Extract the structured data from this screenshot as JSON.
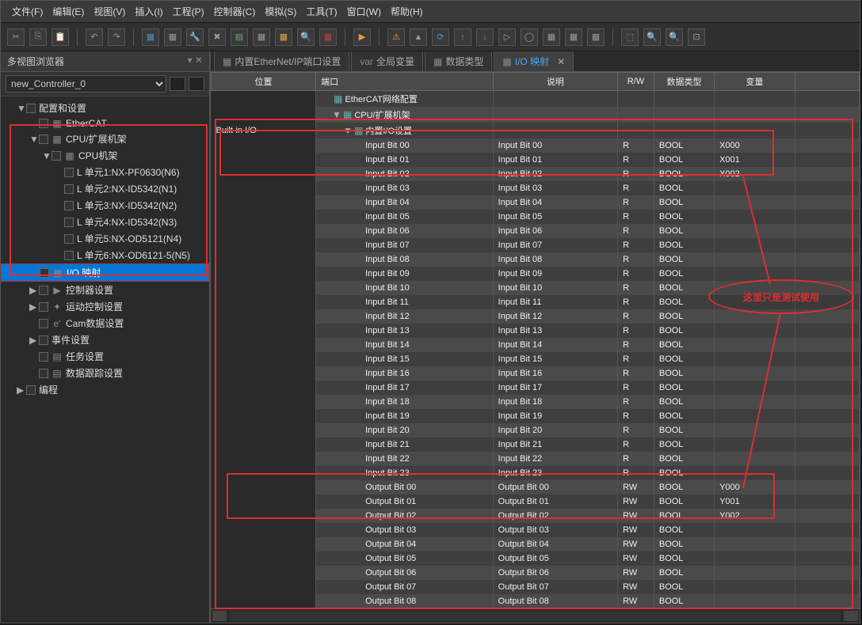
{
  "menu": [
    "文件(F)",
    "编辑(E)",
    "视图(V)",
    "插入(I)",
    "工程(P)",
    "控制器(C)",
    "模拟(S)",
    "工具(T)",
    "窗口(W)",
    "帮助(H)"
  ],
  "sidebar": {
    "title": "多视图浏览器",
    "controller": "new_Controller_0",
    "tree": [
      {
        "label": "配置和设置",
        "cls": "ind-1",
        "arrow": "▼"
      },
      {
        "label": "EtherCAT",
        "cls": "ind-2",
        "icon": "▦"
      },
      {
        "label": "CPU/扩展机架",
        "cls": "ind-2",
        "arrow": "▼",
        "icon": "▦"
      },
      {
        "label": "CPU机架",
        "cls": "ind-3",
        "arrow": "▼",
        "icon": "▦"
      },
      {
        "label": "单元1:NX-PF0630(N6)",
        "cls": "ind-4",
        "pre": "L "
      },
      {
        "label": "单元2:NX-ID5342(N1)",
        "cls": "ind-4",
        "pre": "L "
      },
      {
        "label": "单元3:NX-ID5342(N2)",
        "cls": "ind-4",
        "pre": "L "
      },
      {
        "label": "单元4:NX-ID5342(N3)",
        "cls": "ind-4",
        "pre": "L "
      },
      {
        "label": "单元5:NX-OD5121(N4)",
        "cls": "ind-4",
        "pre": "L "
      },
      {
        "label": "单元6:NX-OD6121-5(N5)",
        "cls": "ind-4",
        "pre": "L "
      },
      {
        "label": "I/O 映射",
        "cls": "ind-2",
        "sel": true,
        "icon": "▦"
      },
      {
        "label": "控制器设置",
        "cls": "ind-2",
        "arrow": "▶",
        "icon": "▶"
      },
      {
        "label": "运动控制设置",
        "cls": "ind-2",
        "arrow": "▶",
        "icon": "✦"
      },
      {
        "label": "Cam数据设置",
        "cls": "ind-2",
        "icon": "e'"
      },
      {
        "label": "事件设置",
        "cls": "ind-2",
        "arrow": "▶",
        "icon": ""
      },
      {
        "label": "任务设置",
        "cls": "ind-2",
        "icon": "▤"
      },
      {
        "label": "数据跟踪设置",
        "cls": "ind-2",
        "icon": "▤"
      },
      {
        "label": "编程",
        "cls": "ind-1",
        "arrow": "▶"
      }
    ]
  },
  "tabs": [
    {
      "label": "内置EtherNet/IP端口设置",
      "ico": "▦"
    },
    {
      "label": "全局变量",
      "ico": "var"
    },
    {
      "label": "数据类型",
      "ico": "▦"
    },
    {
      "label": "I/O 映射",
      "ico": "▦",
      "active": true
    }
  ],
  "columns": [
    "位置",
    "端口",
    "说明",
    "R/W",
    "数据类型",
    "变量",
    ""
  ],
  "headerRows": [
    {
      "pos": "",
      "port": "EtherCAT网络配置",
      "cls": "port-ind-1",
      "tri": "",
      "ico": "▦"
    },
    {
      "pos": "",
      "port": "CPU/扩展机架",
      "cls": "port-ind-1",
      "tri": "▼",
      "ico": "▦"
    },
    {
      "pos": "Built-in I/O",
      "port": "内置I/O设置",
      "cls": "port-ind-2",
      "tri": "▼",
      "ico": "▦"
    }
  ],
  "rows": [
    {
      "port": "Input Bit 00",
      "desc": "Input Bit 00",
      "rw": "R",
      "dt": "BOOL",
      "var": "X000"
    },
    {
      "port": "Input Bit 01",
      "desc": "Input Bit 01",
      "rw": "R",
      "dt": "BOOL",
      "var": "X001"
    },
    {
      "port": "Input Bit 02",
      "desc": "Input Bit 02",
      "rw": "R",
      "dt": "BOOL",
      "var": "X002"
    },
    {
      "port": "Input Bit 03",
      "desc": "Input Bit 03",
      "rw": "R",
      "dt": "BOOL",
      "var": ""
    },
    {
      "port": "Input Bit 04",
      "desc": "Input Bit 04",
      "rw": "R",
      "dt": "BOOL",
      "var": ""
    },
    {
      "port": "Input Bit 05",
      "desc": "Input Bit 05",
      "rw": "R",
      "dt": "BOOL",
      "var": ""
    },
    {
      "port": "Input Bit 06",
      "desc": "Input Bit 06",
      "rw": "R",
      "dt": "BOOL",
      "var": ""
    },
    {
      "port": "Input Bit 07",
      "desc": "Input Bit 07",
      "rw": "R",
      "dt": "BOOL",
      "var": ""
    },
    {
      "port": "Input Bit 08",
      "desc": "Input Bit 08",
      "rw": "R",
      "dt": "BOOL",
      "var": ""
    },
    {
      "port": "Input Bit 09",
      "desc": "Input Bit 09",
      "rw": "R",
      "dt": "BOOL",
      "var": ""
    },
    {
      "port": "Input Bit 10",
      "desc": "Input Bit 10",
      "rw": "R",
      "dt": "BOOL",
      "var": ""
    },
    {
      "port": "Input Bit 11",
      "desc": "Input Bit 11",
      "rw": "R",
      "dt": "BOOL",
      "var": ""
    },
    {
      "port": "Input Bit 12",
      "desc": "Input Bit 12",
      "rw": "R",
      "dt": "BOOL",
      "var": ""
    },
    {
      "port": "Input Bit 13",
      "desc": "Input Bit 13",
      "rw": "R",
      "dt": "BOOL",
      "var": ""
    },
    {
      "port": "Input Bit 14",
      "desc": "Input Bit 14",
      "rw": "R",
      "dt": "BOOL",
      "var": ""
    },
    {
      "port": "Input Bit 15",
      "desc": "Input Bit 15",
      "rw": "R",
      "dt": "BOOL",
      "var": ""
    },
    {
      "port": "Input Bit 16",
      "desc": "Input Bit 16",
      "rw": "R",
      "dt": "BOOL",
      "var": ""
    },
    {
      "port": "Input Bit 17",
      "desc": "Input Bit 17",
      "rw": "R",
      "dt": "BOOL",
      "var": ""
    },
    {
      "port": "Input Bit 18",
      "desc": "Input Bit 18",
      "rw": "R",
      "dt": "BOOL",
      "var": ""
    },
    {
      "port": "Input Bit 19",
      "desc": "Input Bit 19",
      "rw": "R",
      "dt": "BOOL",
      "var": ""
    },
    {
      "port": "Input Bit 20",
      "desc": "Input Bit 20",
      "rw": "R",
      "dt": "BOOL",
      "var": ""
    },
    {
      "port": "Input Bit 21",
      "desc": "Input Bit 21",
      "rw": "R",
      "dt": "BOOL",
      "var": ""
    },
    {
      "port": "Input Bit 22",
      "desc": "Input Bit 22",
      "rw": "R",
      "dt": "BOOL",
      "var": ""
    },
    {
      "port": "Input Bit 23",
      "desc": "Input Bit 23",
      "rw": "R",
      "dt": "BOOL",
      "var": ""
    },
    {
      "port": "Output Bit 00",
      "desc": "Output Bit 00",
      "rw": "RW",
      "dt": "BOOL",
      "var": "Y000"
    },
    {
      "port": "Output Bit 01",
      "desc": "Output Bit 01",
      "rw": "RW",
      "dt": "BOOL",
      "var": "Y001"
    },
    {
      "port": "Output Bit 02",
      "desc": "Output Bit 02",
      "rw": "RW",
      "dt": "BOOL",
      "var": "Y002"
    },
    {
      "port": "Output Bit 03",
      "desc": "Output Bit 03",
      "rw": "RW",
      "dt": "BOOL",
      "var": ""
    },
    {
      "port": "Output Bit 04",
      "desc": "Output Bit 04",
      "rw": "RW",
      "dt": "BOOL",
      "var": ""
    },
    {
      "port": "Output Bit 05",
      "desc": "Output Bit 05",
      "rw": "RW",
      "dt": "BOOL",
      "var": ""
    },
    {
      "port": "Output Bit 06",
      "desc": "Output Bit 06",
      "rw": "RW",
      "dt": "BOOL",
      "var": ""
    },
    {
      "port": "Output Bit 07",
      "desc": "Output Bit 07",
      "rw": "RW",
      "dt": "BOOL",
      "var": ""
    },
    {
      "port": "Output Bit 08",
      "desc": "Output Bit 08",
      "rw": "RW",
      "dt": "BOOL",
      "var": ""
    }
  ],
  "annotation_text": "这里只是测试使用"
}
